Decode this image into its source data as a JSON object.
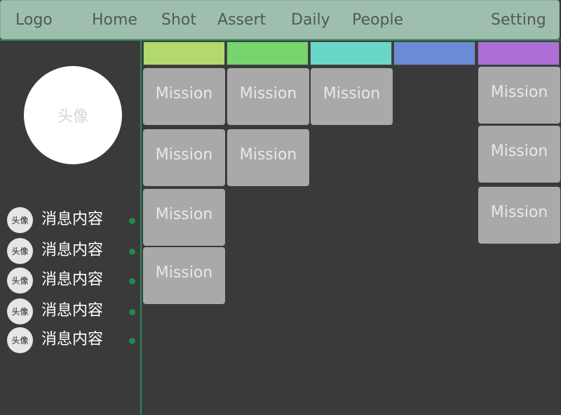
{
  "nav": {
    "logo": "Logo",
    "items": [
      "Home",
      "Shot",
      "Assert",
      "Daily",
      "People"
    ],
    "setting": "Setting"
  },
  "profile": {
    "avatar_label": "头像"
  },
  "messages": [
    {
      "avatar": "头像",
      "text": "消息内容"
    },
    {
      "avatar": "头像",
      "text": "消息内容"
    },
    {
      "avatar": "头像",
      "text": "消息内容"
    },
    {
      "avatar": "头像",
      "text": "消息内容"
    },
    {
      "avatar": "头像",
      "text": "消息内容"
    }
  ],
  "board": {
    "columns": [
      {
        "color": "#b3d96c",
        "cards": [
          "Mission",
          "Mission",
          "Mission",
          "Mission"
        ]
      },
      {
        "color": "#77d46f",
        "cards": [
          "Mission",
          "Mission"
        ]
      },
      {
        "color": "#6ad6c9",
        "cards": [
          "Mission"
        ]
      },
      {
        "color": "#6b8bd6",
        "cards": []
      },
      {
        "color": "#ad6fd6",
        "cards": [
          "Mission",
          "Mission",
          "Mission"
        ]
      }
    ]
  },
  "colors": {
    "nav_bg": "#9fbfae",
    "accent_line": "#2e8a5a",
    "status_dot": "#1f8a4c",
    "card_bg": "#a9a9a9",
    "background": "#3a3a3a"
  }
}
